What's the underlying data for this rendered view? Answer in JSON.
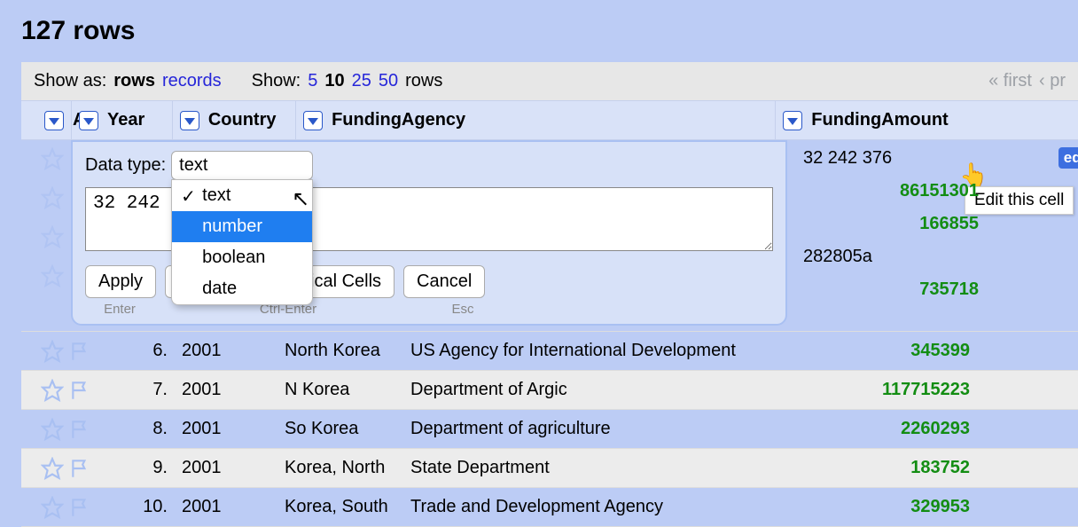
{
  "summary": {
    "row_count_label": "127 rows"
  },
  "toolbar": {
    "show_as_label": "Show as:",
    "rows_label": "rows",
    "records_label": "records",
    "show_label": "Show:",
    "page_sizes": [
      "5",
      "10",
      "25",
      "50"
    ],
    "page_size_current": "10",
    "rows_suffix": "rows",
    "first_label": "« first",
    "prev_label": "‹ pr"
  },
  "columns": {
    "all": "All",
    "year": "Year",
    "country": "Country",
    "agency": "FundingAgency",
    "amount": "FundingAmount"
  },
  "first_row": {
    "amount_raw": "32 242 376",
    "edit_label": "edit",
    "tooltip": "Edit this cell"
  },
  "stacked": {
    "v1": "86151301",
    "v2": "166855",
    "v3_plain": "282805a",
    "v4": "735718"
  },
  "rows": [
    {
      "n": "6.",
      "year": "2001",
      "country": "North Korea",
      "agency": "US Agency for International Development",
      "amount": "345399"
    },
    {
      "n": "7.",
      "year": "2001",
      "country": "N Korea",
      "agency": "Department of Argic",
      "amount": "117715223"
    },
    {
      "n": "8.",
      "year": "2001",
      "country": "So Korea",
      "agency": "Department of agriculture",
      "amount": "2260293"
    },
    {
      "n": "9.",
      "year": "2001",
      "country": "Korea, North",
      "agency": "State Department",
      "amount": "183752"
    },
    {
      "n": "10.",
      "year": "2001",
      "country": "Korea, South",
      "agency": "Trade and Development Agency",
      "amount": "329953"
    }
  ],
  "popup": {
    "type_label": "Data type:",
    "current_value": "32 242",
    "options": {
      "text": "text",
      "number": "number",
      "boolean": "boolean",
      "date": "date"
    },
    "apply": "Apply",
    "apply_all": "Apply to All Identical Cells",
    "cancel": "Cancel",
    "hint_enter": "Enter",
    "hint_ctrl": "Ctrl-Enter",
    "hint_esc": "Esc"
  }
}
